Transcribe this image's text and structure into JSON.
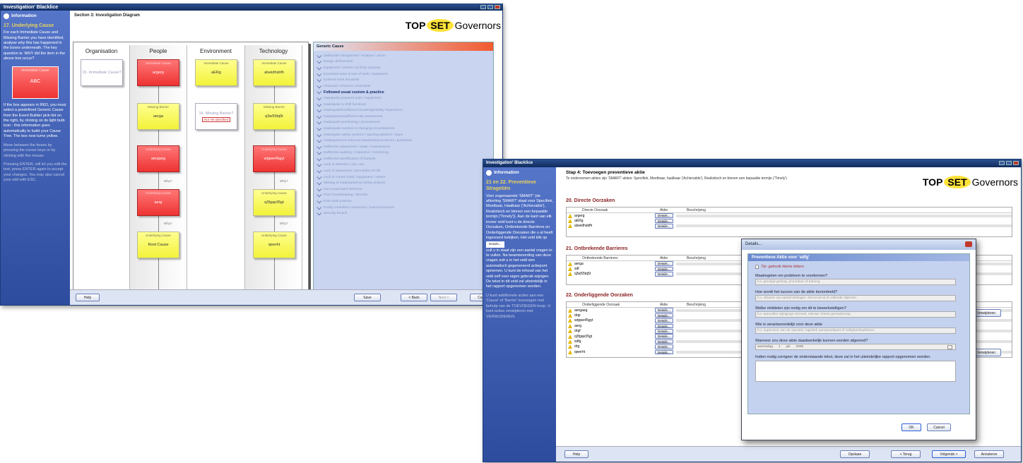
{
  "w1": {
    "title": "Investigation' Blacklice",
    "section": "Section 3: Investigation Diagram",
    "logo": {
      "top": "TOP",
      "set": "SET",
      "gov": "Governors"
    },
    "info": {
      "heading": "Information",
      "step": "17. Underlying Cause",
      "p1": "For each Immediate Cause and Missing Barrier you have identified, analyse why this has happened in the boxes underneath. The key question is: WHY did the item in the above box occur?",
      "card_label": "Immediate Cause",
      "card_value": "ABC",
      "p2": "If the box appears in RED, you must select a predefined Generic Cause from the Event Builder pick-list on the right, by clicking on its light bulb icon - this information goes automatically to build your Cause Tree. The box now turns yellow.",
      "p3": "Move between the boxes by pressing the cursor keys or by clicking with the mouse.",
      "p4": "Pressing ENTER, will let you edit the text, press ENTER again to accept your changes. You may also cancel your edit with ESC."
    },
    "cols": [
      "Organisation",
      "People",
      "Environment",
      "Technology"
    ],
    "nodes": {
      "org": {
        "l": "",
        "v": "15. Immediate Cause?"
      },
      "p1": {
        "l": "Immediate Cause",
        "v": "argerg"
      },
      "p2": {
        "l": "Missing Barrier",
        "v": "aerga"
      },
      "p3": {
        "l": "Underlying Cause",
        "v": "aergaeg"
      },
      "p4": {
        "l": "Underlying Cause",
        "v": "aerg"
      },
      "p5": {
        "l": "Underlying Cause",
        "v": "Root Cause"
      },
      "e1": {
        "l": "Immediate Cause",
        "v": "aERg"
      },
      "e2": {
        "l": "",
        "v": "16. Missing Barrier?",
        "tag": "Not Yet Identified"
      },
      "t1": {
        "l": "Immediate Cause",
        "v": "alseidhsbfh"
      },
      "t2": {
        "l": "Missing Barrier",
        "v": "q3w55tq5t"
      },
      "t3": {
        "l": "Underlying Cause",
        "v": "wtgwe45gyt"
      },
      "t4": {
        "l": "Underlying Cause",
        "v": "q3fgqe35gt"
      },
      "t5": {
        "l": "Underlying Cause",
        "v": "qwerht"
      }
    },
    "why": "Why?",
    "generic": {
      "header": "Generic Cause",
      "items": [
        "Deliberate infringement / violation / action",
        "Design deficiencies",
        "Equipment / vehicle not fit for purpose",
        "Excessive wear & tear of tools / equipment",
        "Extreme work demands",
        "Financial / resource constraints",
        "Followed usual custom & practice",
        "Improperly prepared tools / equipment",
        "Inadequate in-shift handover",
        "Inadequate/insufficient knowledge/ability /experience",
        "Inadequate/insufficient risk assessment",
        "Inadequate purchasing / procurement",
        "Inadequate reaction to changing circumstances",
        "Inadequate safety systems / warning systems / signs",
        "Inadequate/not enforced standards/procedures / guidelines",
        "Ineffective adjustment / repair / maintenance",
        "Ineffective auditing / inspection / monitoring",
        "Ineffective identification of hazards",
        "Lack of attention / eye care",
        "Lack of awareness / perception of risk",
        "Lack of correct tools / equipment / vessel",
        "Missing or inadequate/not safety analysis",
        "Non-cooperative behavior",
        "Poor housekeeping / disorder",
        "Poor work practice",
        "Poorly controlled contractors / external sources",
        "Security breach"
      ],
      "bold_idx": 6
    },
    "btns": {
      "help": "Help",
      "save": "Save",
      "back": "< Back",
      "next": "Next >",
      "cancel": "Cancel"
    }
  },
  "w2": {
    "title": "Investigation' Blacklice",
    "step": "Stap 4: Toevoegen preventieve aktie",
    "sub": "Te ondernemen akties zijn 'SMART' akties: Specifiek, Meetbaar, haalbaar ('Achievable'), Realistisch en binnen een bepaalde termijn ('Timely')",
    "info": {
      "heading": "Information",
      "step": "21 en 22. Preventieve Stragetiën",
      "text": "Voer zogenaamde 'SMART' (de afkorting 'SMART' staat voor Specifiek, Meetbaar, Haalbaar ('Achievable'), Realistisch en binnen een bepaalde termijn ('Timely')). Aan de kant van elk invoer veld kunt u de directe Oorzaken, Ontbrekende Barrières en Onderliggende Oorzaken die u al heeft ingevoerd bekijken. Het veld klik op",
      "text2": "zult u in staat zijn een aantal vragen in te vullen. Na beantwoording van deze vragen zult u in het veld een automatisch gegenereerd actiepunt opnemen. U kunt de inhoud van het veld zelf voor eigen gebruik wijzigen. De tekst in dit veld zal uiteindelijk in het rapport opgenomen worden.",
      "text3": "U kunt additionele acties aan een 'Cause' of 'Barrier' toevoegen met behulp van de TOEVOEGEN knop. U kunt acties verwijderen met VERWIJDEREN."
    },
    "logo": {
      "top": "TOP",
      "set": "SET",
      "gov": "Governors"
    },
    "sec20": {
      "title": "20. Directe Oorzaken",
      "cols": [
        "Directe Oorzaak",
        "Aktie",
        "Beschrijving"
      ],
      "rows": [
        "argerg",
        "aERg",
        "alseidhsbfh"
      ]
    },
    "sec21": {
      "title": "21. Ontbrekende Barrieres",
      "cols": [
        "Ontbrekende Barrieres",
        "Aktie",
        "Beschrijving"
      ],
      "rows": [
        "aerga",
        "sdf",
        "q3w55tq5t"
      ]
    },
    "sec22": {
      "title": "22. Onderliggende Oorzaken",
      "cols": [
        "Onderliggende Oorzaak",
        "Aktie",
        "Beschrijving"
      ],
      "rows": [
        "aergaeg",
        "drgr",
        "wtgwe45gyt",
        "aerg",
        "drgf",
        "q3fgqe35gt",
        "sdfg",
        "drg",
        "qwerht"
      ]
    },
    "details_btn": "Details...",
    "remove_btn": "Verwijderen",
    "btns": {
      "help": "Help",
      "save": "Opslaan",
      "back": "< Terug",
      "next": "Volgende >",
      "cancel": "Annuleren"
    },
    "dialog": {
      "title": "Details...",
      "header": "Preventieve Aktie voor 'sdfg'",
      "tip": "Tip: gebruik kleine letters",
      "q1": "Maatregelen om probleem te voorkomen?",
      "f1": "b.v. gevolgd gedrag, procedure of training",
      "q2": "Hoe wordt het succes van de aktie beoordeeld?",
      "f2": "b.v. afname van aantal lekkages, stroomuit-al of vallende objecten",
      "q3": "Welke middelen zijn nodig om dit te bewerkstelligen?",
      "f3": "b.v. aanvullen wijzigings verzoek, nieuwe criteria gereedschap",
      "q4": "Wie is verantwoordelijk voor deze aktie",
      "f4": "b.v. supervisor van de operatie, logistiek aanspreekpunt of veiligheidsadviseur",
      "q5": "Wanneer zou deze aktie daadwerkelijk kunnen worden afgerond?",
      "date": [
        "woensdag",
        "1",
        "juli",
        "2009"
      ],
      "q6": "Indien nodig corrigeer de onderstaande tekst, deze zal in het uiteindelijke rapport opgenomen worden.",
      "ok": "OK",
      "cancel": "Cancel"
    }
  }
}
